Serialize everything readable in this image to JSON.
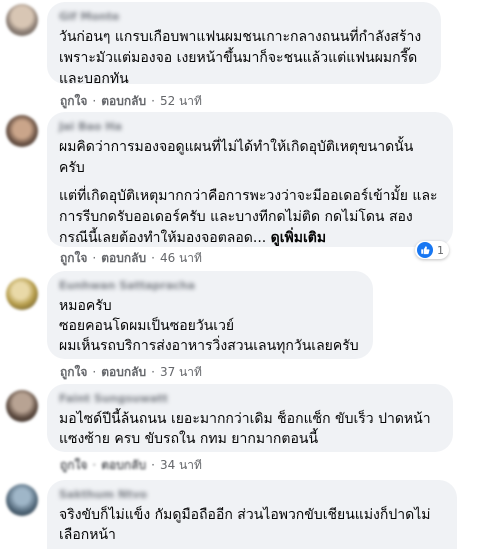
{
  "comments": [
    {
      "author": "Gif Monte",
      "paragraphs": [
        [
          "วันก่อนๆ แกรบเกือบพาแฟนผมชนเกาะกลางถนนที่กำลังสร้าง",
          "เพราะมัวแต่มองจอ เงยหน้าขึ้นมาก็จะชนแล้วแต่แฟนผมกรี๊ด",
          "และบอกทัน"
        ]
      ],
      "like_label": "ถูกใจ",
      "reply_label": "ตอบกลับ",
      "time": "52 นาที"
    },
    {
      "author": "Jai Bao Ha",
      "paragraphs": [
        [
          "ผมคิดว่าการมองจอดูแผนที่ไม่ได้ทำให้เกิดอุบัติเหตุขนาดนั้น",
          "ครับ"
        ],
        [
          "แต่ที่เกิดอุบัติเหตุมากกว่าคือการพะวงว่าจะมีออเดอร์เข้ามั้ย และ",
          "การรีบกดรับออเดอร์ครับ และบางทีกดไม่ติด กดไม่โดน สอง",
          "กรณีนี้เลยต้องทำให้มองจอตลอด..."
        ]
      ],
      "see_more": "ดูเพิ่มเติม",
      "reaction_count": "1",
      "like_label": "ถูกใจ",
      "reply_label": "ตอบกลับ",
      "time": "46 นาที"
    },
    {
      "author": "Eunhwan Sattapracha",
      "paragraphs": [
        [
          "หมอครับ",
          "ซอยคอนโดผมเป็นซอยวันเวย์",
          "ผมเห็นรถบริการส่งอาหารวิ่งสวนเลนทุกวันเลยครับ"
        ]
      ],
      "like_label": "ถูกใจ",
      "reply_label": "ตอบกลับ",
      "time": "37 นาที"
    },
    {
      "author": "Faint Sungsuwatt",
      "paragraphs": [
        [
          "มอไซด์ปีนี้ล้นถนน เยอะมากกว่าเดิม ช็อกแซ็ก ขับเร็ว ปาดหน้า",
          "แซงซ้าย ครบ ขับรถใน กทม ยากมากตอนนี้"
        ]
      ],
      "like_label": "ถูกใจ",
      "reply_label": "ตอบกลับ",
      "time": "34 นาที"
    },
    {
      "author": "Sakthum Ntvo",
      "paragraphs": [
        [
          "จริงขับก็ไม่แข็ง กัมดูมือถืออีก ส่วนไอพวกขับเชียนแม่งก็ปาดไม่",
          "เลือกหน้า"
        ]
      ]
    }
  ],
  "colors": {
    "bubble": "#f0f2f5",
    "secondary_text": "#65676b",
    "like_blue": "#1877f2"
  },
  "icons": {
    "reaction": "thumbs-up-icon"
  }
}
